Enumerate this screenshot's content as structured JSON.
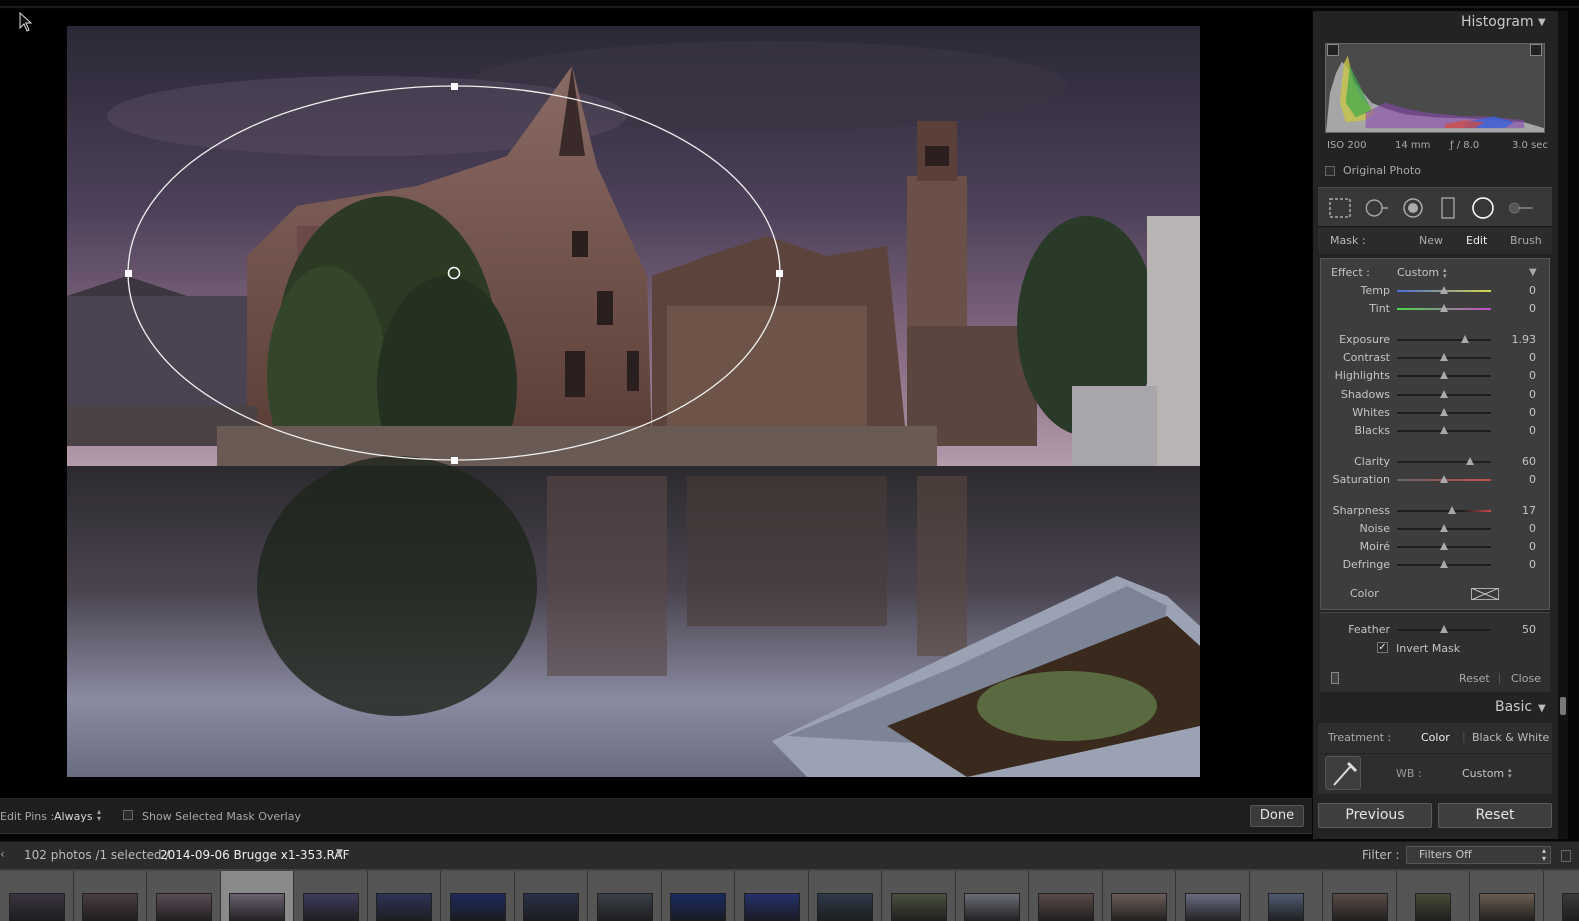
{
  "histogram": {
    "title": "Histogram",
    "iso": "ISO 200",
    "focal": "14 mm",
    "aperture": "ƒ / 8.0",
    "shutter": "3.0 sec",
    "original_photo_label": "Original Photo"
  },
  "mask": {
    "label": "Mask :",
    "new": "New",
    "edit": "Edit",
    "brush": "Brush"
  },
  "effect": {
    "label": "Effect :",
    "value": "Custom"
  },
  "sliders": [
    {
      "label": "Temp",
      "value": "0",
      "pos": 0.5
    },
    {
      "label": "Tint",
      "value": "0",
      "pos": 0.5
    },
    {
      "label": "Exposure",
      "value": "1.93",
      "pos": 0.72
    },
    {
      "label": "Contrast",
      "value": "0",
      "pos": 0.5
    },
    {
      "label": "Highlights",
      "value": "0",
      "pos": 0.5
    },
    {
      "label": "Shadows",
      "value": "0",
      "pos": 0.5
    },
    {
      "label": "Whites",
      "value": "0",
      "pos": 0.5
    },
    {
      "label": "Blacks",
      "value": "0",
      "pos": 0.5
    },
    {
      "label": "Clarity",
      "value": "60",
      "pos": 0.78
    },
    {
      "label": "Saturation",
      "value": "0",
      "pos": 0.5
    },
    {
      "label": "Sharpness",
      "value": "17",
      "pos": 0.58
    },
    {
      "label": "Noise",
      "value": "0",
      "pos": 0.5
    },
    {
      "label": "Moiré",
      "value": "0",
      "pos": 0.5
    },
    {
      "label": "Defringe",
      "value": "0",
      "pos": 0.5
    }
  ],
  "color_label": "Color",
  "feather": {
    "label": "Feather",
    "value": "50",
    "pos": 0.5
  },
  "invert_mask_label": "Invert Mask",
  "panel_reset": "Reset",
  "panel_close": "Close",
  "basic": {
    "title": "Basic",
    "treatment_label": "Treatment :",
    "color": "Color",
    "bw": "Black & White",
    "wb_label": "WB :",
    "wb_value": "Custom"
  },
  "previous_button": "Previous",
  "reset_button": "Reset",
  "toolbar": {
    "edit_pins_label": "Edit Pins :",
    "edit_pins_value": "Always",
    "overlay_label": "Show Selected Mask Overlay",
    "done": "Done"
  },
  "filmstrip": {
    "info": "102 photos /1 selected /",
    "filename": "2014-09-06 Brugge x1-353.RAF",
    "filter_label": "Filter :",
    "filter_value": "Filters Off"
  }
}
